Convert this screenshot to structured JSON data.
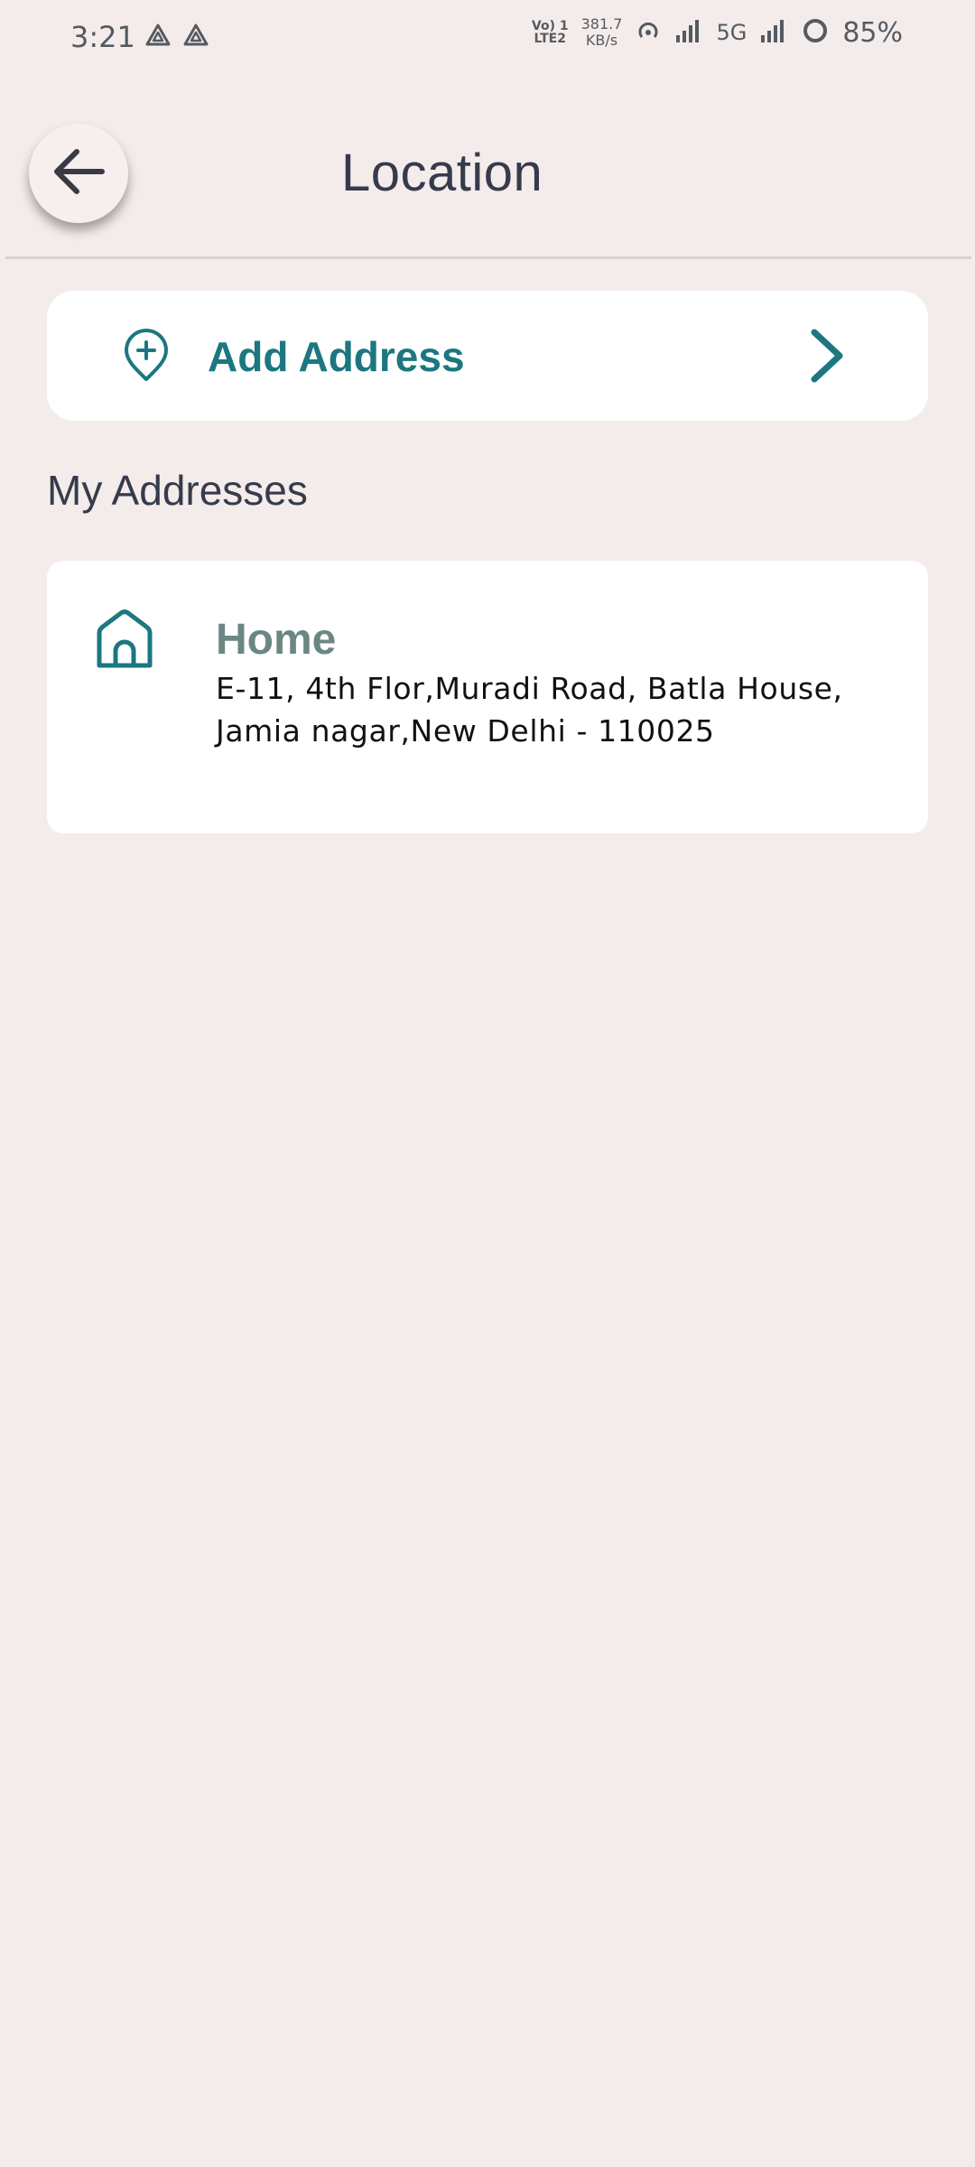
{
  "status_bar": {
    "time": "3:21",
    "volte_line1": "Vo) 1",
    "volte_line2": "LTE2",
    "net_speed_value": "381.7",
    "net_speed_unit": "KB/s",
    "network_type": "5G",
    "battery_percent": "85%"
  },
  "header": {
    "title": "Location",
    "back_icon": "arrow-left-icon"
  },
  "add_address": {
    "label": "Add Address",
    "icon": "location-pin-plus-icon",
    "chevron_icon": "chevron-right-icon"
  },
  "section": {
    "title": "My Addresses"
  },
  "addresses": [
    {
      "label": "Home",
      "icon": "home-icon",
      "address": "E-11, 4th Flor,Muradi Road, Batla House,\n Jamia nagar,New Delhi - 110025"
    }
  ],
  "colors": {
    "background": "#f4eceb",
    "accent_teal": "#1c7780",
    "home_label": "#6b8784",
    "title_text": "#363b4c",
    "card": "#ffffff"
  }
}
